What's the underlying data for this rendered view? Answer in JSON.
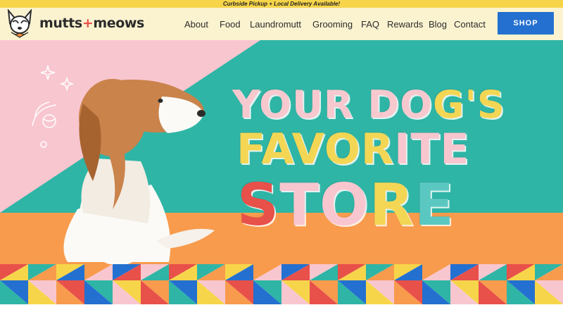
{
  "announcement": "Curbside Pickup + Local Delivery Available!",
  "brand": {
    "name_part1": "mutts",
    "plus": "+",
    "name_part2": "meows"
  },
  "nav": [
    {
      "label": "About"
    },
    {
      "label": "Food"
    },
    {
      "label": "Laundromutt"
    },
    {
      "label": "Grooming"
    },
    {
      "label": "FAQ"
    },
    {
      "label": "Rewards"
    },
    {
      "label": "Blog"
    },
    {
      "label": "Contact"
    }
  ],
  "shop_label": "SHOP",
  "hero": {
    "line1": {
      "a": "YOUR DO",
      "b": "G'S"
    },
    "line2": {
      "a": "FAVOR",
      "b": "ITE"
    },
    "line3": {
      "a": "S",
      "b": "TO",
      "c": "R",
      "d": "E"
    }
  },
  "colors": {
    "pink": "#f8c6cf",
    "teal": "#2fb5a6",
    "orange": "#f89b4d",
    "yellow": "#f7d54a",
    "blue": "#2470d0",
    "red": "#e8504a",
    "cream": "#fbf3d0"
  }
}
